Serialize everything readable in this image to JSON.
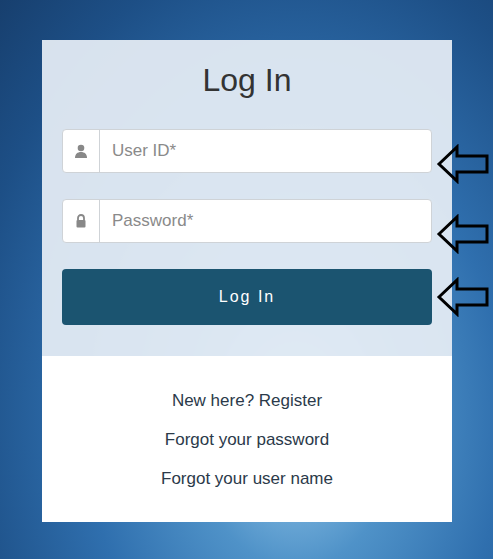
{
  "title": "Log In",
  "fields": [
    {
      "placeholder": "User ID*",
      "kind": "user"
    },
    {
      "placeholder": "Password*",
      "kind": "password"
    }
  ],
  "login_button": "Log In",
  "links": [
    "New here? Register",
    "Forgot your password",
    "Forgot your user name"
  ]
}
